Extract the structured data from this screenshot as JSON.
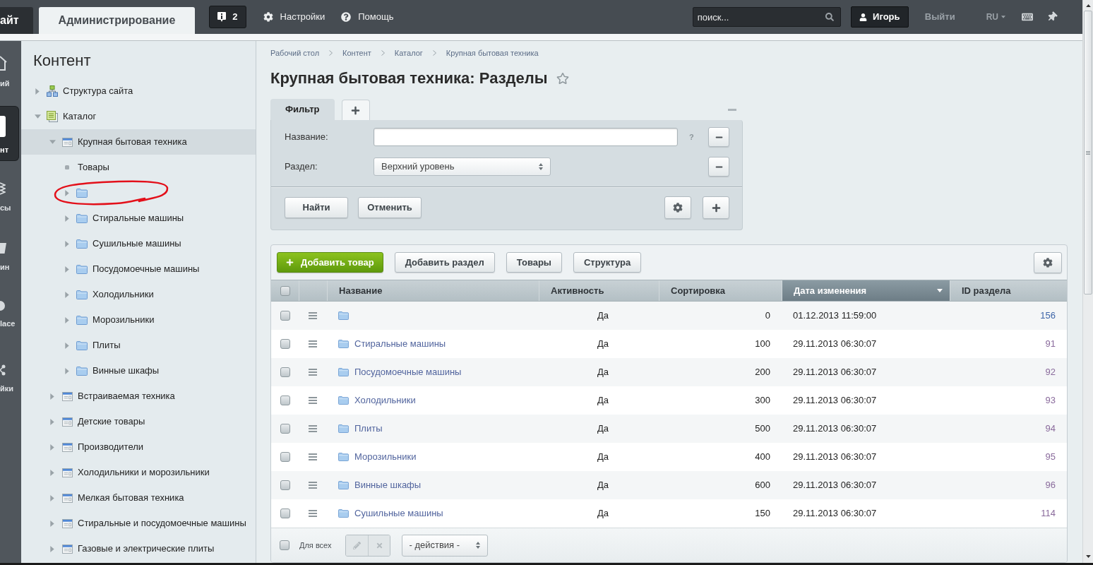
{
  "top_bar": {
    "tabs": [
      {
        "label": "айт",
        "selected": false
      },
      {
        "label": "Администрирование",
        "selected": true
      }
    ],
    "notifications": {
      "count": "2"
    },
    "links": [
      {
        "kind": "settings",
        "label": "Настройки"
      },
      {
        "kind": "help",
        "label": "Помощь"
      }
    ],
    "search": {
      "placeholder": "поиск..."
    },
    "user": {
      "name": "Игорь"
    },
    "logout": "Выйти",
    "language": "RU"
  },
  "left_menu": [
    {
      "kind": "home",
      "label": "ий",
      "selected": false
    },
    {
      "kind": "content",
      "label": "нт",
      "selected": true
    },
    {
      "kind": "services",
      "label": "сы",
      "selected": false
    },
    {
      "kind": "shop",
      "label": "ин",
      "selected": false
    },
    {
      "kind": "marketplace",
      "label": "lace",
      "selected": false
    },
    {
      "kind": "settings",
      "label": "йки",
      "selected": false
    }
  ],
  "sidebar": {
    "title": "Контент",
    "items": [
      {
        "kind": "structure",
        "label": "Структура сайта",
        "expanded": false,
        "selected": false
      },
      {
        "kind": "catalog",
        "label": "Каталог",
        "expanded": true,
        "selected": false,
        "children": [
          {
            "kind": "iblock",
            "label": "Крупная бытовая техника",
            "expanded": true,
            "selected": true,
            "children": [
              {
                "kind": "leaf",
                "label": "Товары",
                "selected": false,
                "highlight": false
              },
              {
                "kind": "folder",
                "expanded": false,
                "selected": false,
                "highlight": true
              },
              {
                "kind": "folder",
                "label": "Стиральные машины",
                "expanded": false,
                "selected": false,
                "highlight": false
              },
              {
                "kind": "folder",
                "label": "Сушильные машины",
                "expanded": false,
                "selected": false,
                "highlight": false
              },
              {
                "kind": "folder",
                "label": "Посудомоечные машины",
                "expanded": false,
                "selected": false,
                "highlight": false
              },
              {
                "kind": "folder",
                "label": "Холодильники",
                "expanded": false,
                "selected": false,
                "highlight": false
              },
              {
                "kind": "folder",
                "label": "Морозильники",
                "expanded": false,
                "selected": false,
                "highlight": false
              },
              {
                "kind": "folder",
                "label": "Плиты",
                "expanded": false,
                "selected": false,
                "highlight": false
              },
              {
                "kind": "folder",
                "label": "Винные шкафы",
                "expanded": false,
                "selected": false,
                "highlight": false
              }
            ]
          },
          {
            "kind": "iblock",
            "label": "Встраиваемая техника",
            "expanded": false,
            "selected": false
          },
          {
            "kind": "iblock",
            "label": "Детские товары",
            "expanded": false,
            "selected": false
          },
          {
            "kind": "iblock",
            "label": "Производители",
            "expanded": false,
            "selected": false
          },
          {
            "kind": "iblock",
            "label": "Холодильники и морозильники",
            "expanded": false,
            "selected": false
          },
          {
            "kind": "iblock",
            "label": "Мелкая бытовая техника",
            "expanded": false,
            "selected": false
          },
          {
            "kind": "iblock",
            "label": "Стиральные и посудомоечные машины",
            "expanded": false,
            "selected": false
          },
          {
            "kind": "iblock",
            "label": "Газовые и электрические плиты",
            "expanded": false,
            "selected": false
          }
        ]
      }
    ]
  },
  "breadcrumbs": [
    "Рабочий стол",
    "Контент",
    "Каталог",
    "Крупная бытовая техника"
  ],
  "page_title": {
    "text": "Крупная бытовая техника: Разделы",
    "favorite": false
  },
  "filter": {
    "tabs": [
      {
        "kind": "text",
        "label": "Фильтр",
        "selected": true
      },
      {
        "kind": "add",
        "selected": false
      }
    ],
    "fields": [
      {
        "kind": "text",
        "label": "Название:",
        "help": "?"
      },
      {
        "kind": "select",
        "label": "Раздел:",
        "value": "Верхний уровень"
      }
    ],
    "buttons": [
      "Найти",
      "Отменить"
    ]
  },
  "toolbar": {
    "buttons": [
      {
        "kind": "primary",
        "label": "Добавить товар"
      },
      {
        "kind": "default",
        "label": "Добавить раздел"
      },
      {
        "kind": "default",
        "label": "Товары"
      },
      {
        "kind": "default",
        "label": "Структура"
      }
    ]
  },
  "table": {
    "all_checked": false,
    "columns": [
      {
        "label": "Название",
        "sorted": false
      },
      {
        "label": "Активность",
        "sorted": false
      },
      {
        "label": "Сортировка",
        "sorted": false
      },
      {
        "label": "Дата изменения",
        "sorted": true
      },
      {
        "label": "ID раздела",
        "sorted": false
      }
    ],
    "rows": [
      {
        "checked": false,
        "active": "Да",
        "sort": "0",
        "date": "01.12.2013 11:59:00",
        "id": "156",
        "visited": false
      },
      {
        "checked": false,
        "name": "Стиральные машины",
        "active": "Да",
        "sort": "100",
        "date": "29.11.2013 06:30:07",
        "id": "91",
        "visited": true
      },
      {
        "checked": false,
        "name": "Посудомоечные машины",
        "active": "Да",
        "sort": "200",
        "date": "29.11.2013 06:30:07",
        "id": "92",
        "visited": true
      },
      {
        "checked": false,
        "name": "Холодильники",
        "active": "Да",
        "sort": "300",
        "date": "29.11.2013 06:30:07",
        "id": "93",
        "visited": true
      },
      {
        "checked": false,
        "name": "Плиты",
        "active": "Да",
        "sort": "500",
        "date": "29.11.2013 06:30:07",
        "id": "94",
        "visited": true
      },
      {
        "checked": false,
        "name": "Морозильники",
        "active": "Да",
        "sort": "400",
        "date": "29.11.2013 06:30:07",
        "id": "95",
        "visited": true
      },
      {
        "checked": false,
        "name": "Винные шкафы",
        "active": "Да",
        "sort": "600",
        "date": "29.11.2013 06:30:07",
        "id": "96",
        "visited": true
      },
      {
        "checked": false,
        "name": "Сушильные машины",
        "active": "Да",
        "sort": "150",
        "date": "29.11.2013 06:30:07",
        "id": "114",
        "visited": true
      }
    ]
  },
  "footer": {
    "for_all": {
      "label": "Для всех",
      "checked": false
    },
    "row_actions": [
      {
        "kind": "edit",
        "disabled": true
      },
      {
        "kind": "delete",
        "disabled": true
      }
    ],
    "actions_select": "- действия -"
  }
}
